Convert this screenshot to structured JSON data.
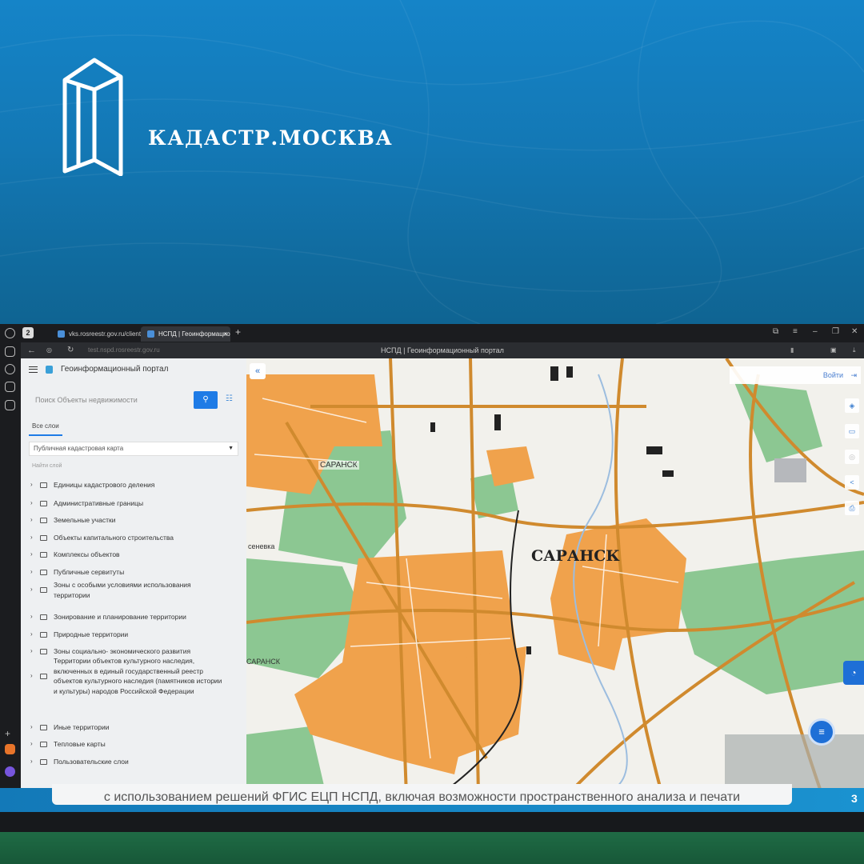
{
  "banner": {
    "brand_name": "КАДАСТР.МОСКВА",
    "logo": "kadastr-crystal-logo",
    "background_color": "#1584c8"
  },
  "browser": {
    "tab_count_badge": "2",
    "tabs": [
      {
        "label": "vks.rosreestr.gov.ru/client",
        "active": false
      },
      {
        "label": "НСПД | Геоинформацио",
        "active": true
      }
    ],
    "url": "test.nspd.rosreestr.gov.ru",
    "page_title": "НСПД | Геоинформационный портал"
  },
  "sidebar": {
    "app_title": "Геоинформационный портал",
    "search_placeholder": "Поиск Объекты недвижимости",
    "tab_all_layers": "Все слои",
    "map_select_value": "Публичная кадастровая карта",
    "find_layer_placeholder": "Найти слой",
    "layers": [
      {
        "label": "Единицы кадастрового деления"
      },
      {
        "label": "Административные границы"
      },
      {
        "label": "Земельные участки"
      },
      {
        "label": "Объекты капитального строительства"
      },
      {
        "label": "Комплексы объектов"
      },
      {
        "label": "Публичные сервитуты"
      },
      {
        "label": "Зоны с особыми условиями использования территории"
      },
      {
        "label": "Зонирование и планирование территории"
      },
      {
        "label": "Природные территории"
      },
      {
        "label": "Зоны социально- экономического развития"
      },
      {
        "label": "Территории объектов культурного наследия, включенных в единый государственный реестр объектов культурного наследия (памятников истории и культуры) народов Российской Федерации"
      },
      {
        "label": "Иные территории"
      },
      {
        "label": "Тепловые карты"
      },
      {
        "label": "Пользовательские слои"
      }
    ]
  },
  "map": {
    "login_label": "Войти",
    "city_label_main": "САРАНСК",
    "city_label_small": "САРАНСК",
    "city_label_small2": "САРАНСК",
    "village_label": "сеневка",
    "colors": {
      "urban": "#f0a24c",
      "green": "#8cc792",
      "road": "#d08a2e",
      "background": "#f2f1ec"
    }
  },
  "caption": {
    "text": "с использованием решений ФГИС ЕЦП НСПД, включая возможности пространственного анализа и печати",
    "page_number": "3"
  }
}
